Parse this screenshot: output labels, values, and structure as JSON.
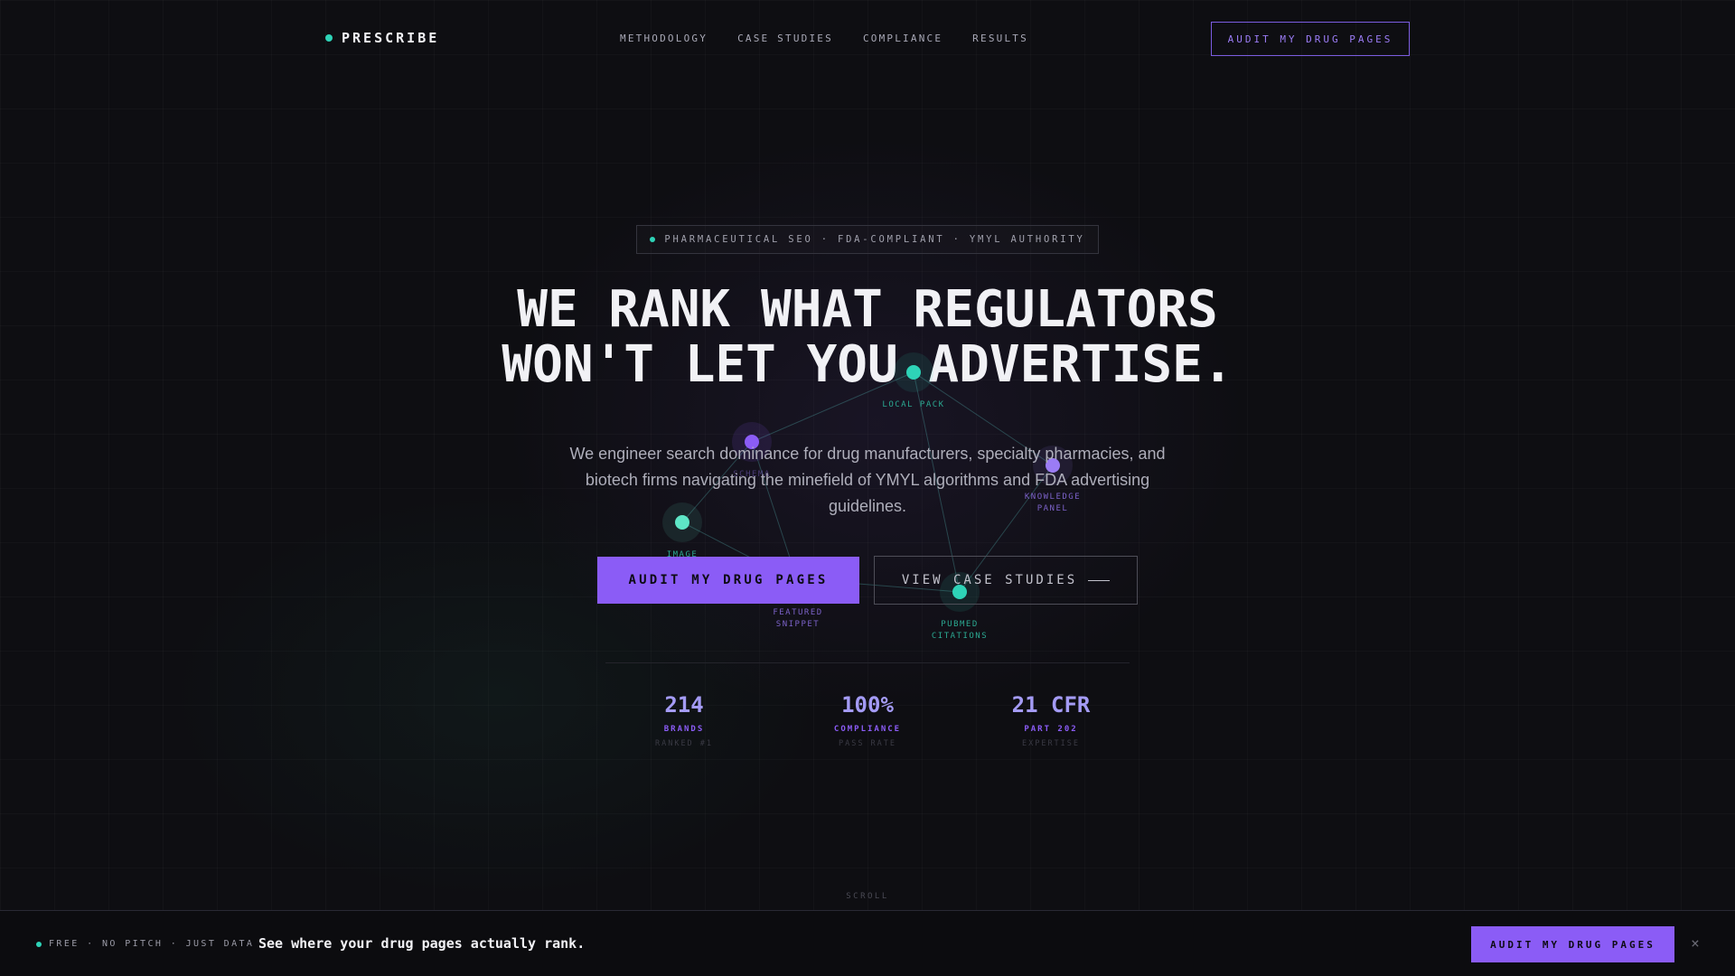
{
  "nav": {
    "logo": "PRESCRIBE",
    "links": [
      "METHODOLOGY",
      "CASE STUDIES",
      "COMPLIANCE",
      "RESULTS"
    ],
    "cta": "AUDIT MY DRUG PAGES"
  },
  "hero": {
    "tagline": "PHARMACEUTICAL SEO · FDA-COMPLIANT · YMYL AUTHORITY",
    "headline_line1": "WE RANK WHAT REGULATORS",
    "headline_line2": "WON'T LET YOU ADVERTISE.",
    "subtitle": "We engineer search dominance for drug manufacturers, specialty pharmacies, and biotech firms navigating the minefield of YMYL algorithms and FDA advertising guidelines.",
    "primary_cta": "AUDIT MY DRUG PAGES",
    "secondary_cta": "VIEW CASE STUDIES"
  },
  "network": {
    "nodes": [
      {
        "label_line1": "LOCAL PACK",
        "label_line2": "",
        "color": "#2ed3b7"
      },
      {
        "label_line1": "KNOWLEDGE",
        "label_line2": "PANEL",
        "color": "#9b7cf5"
      },
      {
        "label_line1": "SCHEMA",
        "label_line2": "",
        "color": "#8b5cf6"
      },
      {
        "label_line1": "IMAGE",
        "label_line2": "",
        "color": "#5ee6c6"
      },
      {
        "label_line1": "FEATURED",
        "label_line2": "SNIPPET",
        "color": "#8b5cf6"
      },
      {
        "label_line1": "PUBMED",
        "label_line2": "CITATIONS",
        "color": "#2ed3b7"
      }
    ]
  },
  "stats": [
    {
      "value": "214",
      "label": "BRANDS",
      "sub": "RANKED #1"
    },
    {
      "value": "100%",
      "label": "COMPLIANCE",
      "sub": "PASS RATE"
    },
    {
      "value": "21 CFR",
      "label": "PART 202",
      "sub": "EXPERTISE"
    }
  ],
  "scroll_label": "SCROLL",
  "bottom_bar": {
    "tag": "FREE · NO PITCH · JUST DATA",
    "text": "See where your drug pages actually rank.",
    "cta": "AUDIT MY DRUG PAGES",
    "close": "×"
  },
  "colors": {
    "accent": "#8b5cf6",
    "teal": "#2ed3b7",
    "background": "#0e0e12"
  }
}
